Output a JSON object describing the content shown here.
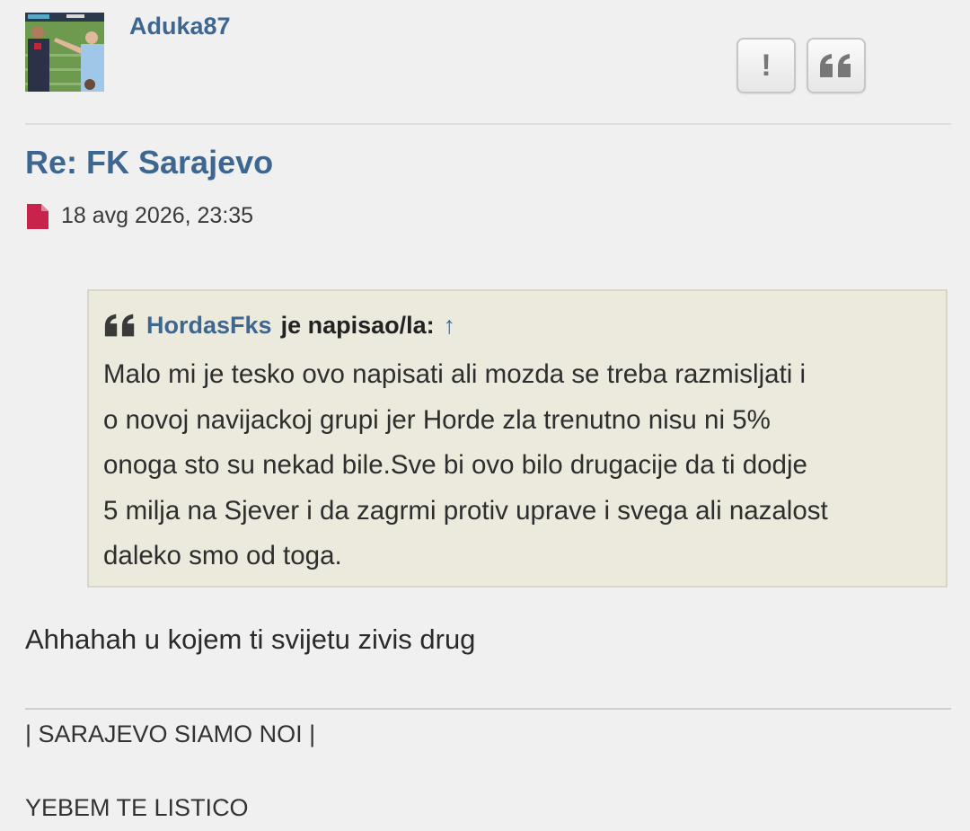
{
  "author": {
    "username": "Aduka87",
    "avatar_icon": "football-players-photo"
  },
  "actions": {
    "report_label": "!",
    "quote_icon": "quote-icon"
  },
  "post": {
    "title": "Re: FK Sarajevo",
    "timestamp": "18 avg 2026, 23:35",
    "post_icon": "document-icon",
    "quote": {
      "author": "HordasFks",
      "said_label": "je napisao/la:",
      "jump_arrow": "↑",
      "lines": [
        "Malo mi je tesko ovo napisati ali mozda se treba razmisljati i",
        "o novoj navijackoj grupi jer Horde zla trenutno nisu ni 5%",
        "onoga sto su nekad bile.Sve bi ovo bilo drugacije da ti dodje",
        "5 milja na Sjever i da zagrmi protiv uprave i svega ali nazalost",
        "daleko smo od toga."
      ]
    },
    "reply": "Ahhahah u kojem ti svijetu zivis drug"
  },
  "signature": {
    "line1": "| SARAJEVO SIAMO NOI |",
    "line2": "YEBEM TE LISTICO"
  },
  "colors": {
    "link": "#3d6690",
    "quote_bg": "#ebeadc",
    "post_icon": "#c8234a",
    "background": "#f0f0f0"
  }
}
